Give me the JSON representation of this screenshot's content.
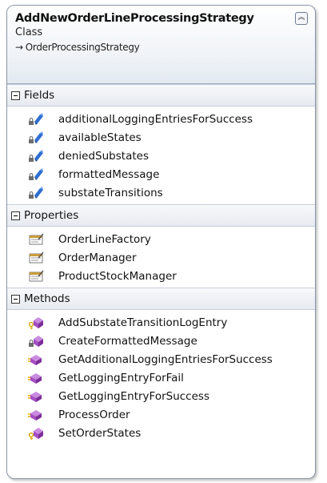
{
  "class_box": {
    "title": "AddNewOrderLineProcessingStrategy",
    "kind": "Class",
    "base_arrow": "→",
    "base": "OrderProcessingStrategy",
    "collapse_glyph": "︽"
  },
  "sections": {
    "fields": {
      "label": "Fields",
      "items": [
        {
          "label": "additionalLoggingEntriesForSuccess",
          "icon": "private-field-icon"
        },
        {
          "label": "availableStates",
          "icon": "private-field-icon"
        },
        {
          "label": "deniedSubstates",
          "icon": "private-field-icon"
        },
        {
          "label": "formattedMessage",
          "icon": "private-field-icon"
        },
        {
          "label": "substateTransitions",
          "icon": "private-field-icon"
        }
      ]
    },
    "properties": {
      "label": "Properties",
      "items": [
        {
          "label": "OrderLineFactory",
          "icon": "property-icon"
        },
        {
          "label": "OrderManager",
          "icon": "property-icon"
        },
        {
          "label": "ProductStockManager",
          "icon": "property-icon"
        }
      ]
    },
    "methods": {
      "label": "Methods",
      "items": [
        {
          "label": "AddSubstateTransitionLogEntry",
          "icon": "protected-method-icon"
        },
        {
          "label": "CreateFormattedMessage",
          "icon": "private-method-icon"
        },
        {
          "label": "GetAdditionalLoggingEntriesForSuccess",
          "icon": "public-method-icon"
        },
        {
          "label": "GetLoggingEntryForFail",
          "icon": "public-method-icon"
        },
        {
          "label": "GetLoggingEntryForSuccess",
          "icon": "public-method-icon"
        },
        {
          "label": "ProcessOrder",
          "icon": "public-method-icon"
        },
        {
          "label": "SetOrderStates",
          "icon": "protected-method-icon"
        }
      ]
    }
  },
  "colors": {
    "field_icon": "#2f6fd1",
    "method_icon": "#a54ec2",
    "lock": "#6d6d6d",
    "key": "#d9a400",
    "property_icon": "#c89b3c"
  }
}
